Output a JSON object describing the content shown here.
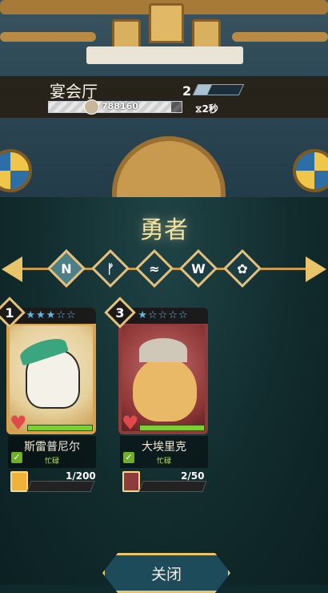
{
  "header": {
    "hall_name": "宴会厅",
    "level": "2",
    "level_progress_fraction": 0.3,
    "progress_text": "788160",
    "progress_fraction": 0.92,
    "timer_text": "2秒",
    "timer_icon": "hourglass-icon"
  },
  "panel": {
    "title": "勇者",
    "filter_tabs": [
      {
        "name": "tab-norse",
        "glyph": "N",
        "active": true
      },
      {
        "name": "tab-axe",
        "glyph": "ᚠ",
        "active": false
      },
      {
        "name": "tab-wing",
        "glyph": "≈",
        "active": false
      },
      {
        "name": "tab-valkyrie",
        "glyph": "W",
        "active": false
      },
      {
        "name": "tab-paw",
        "glyph": "✿",
        "active": false
      }
    ]
  },
  "heroes": [
    {
      "name": "斯雷普尼尔",
      "status": "忙碌",
      "level": "1",
      "stars": "★★★☆☆",
      "shards": "1/200",
      "shard_fraction": 0.005,
      "hp_fraction": 1.0,
      "frame_color": "#d9a24a"
    },
    {
      "name": "大埃里克",
      "status": "忙碌",
      "level": "3",
      "stars": "★☆☆☆☆",
      "shards": "2/50",
      "shard_fraction": 0.04,
      "hp_fraction": 1.0,
      "frame_color": "#8e3b3b"
    }
  ],
  "footer": {
    "close_label": "关闭"
  },
  "colors": {
    "accent_gold": "#e9c46a",
    "hp_green": "#7ad12b",
    "panel_bg": "#112a2c"
  }
}
